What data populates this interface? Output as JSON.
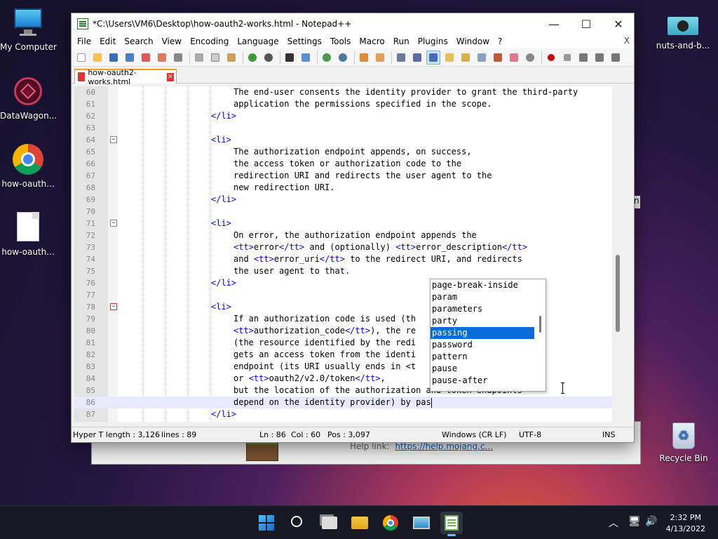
{
  "desktop": {
    "left_icons": [
      {
        "label": "My Computer",
        "icon": "monitor-icon"
      },
      {
        "label": "DataWagon...",
        "icon": "datawagon-icon"
      },
      {
        "label": "how-oauth...",
        "icon": "chrome-icon"
      },
      {
        "label": "how-oauth...",
        "icon": "file-icon"
      }
    ],
    "right_icons": [
      {
        "label": "nuts-and-b...",
        "icon": "image-file-icon"
      },
      {
        "label": "Recycle Bin",
        "icon": "recycle-bin-icon"
      }
    ]
  },
  "bg_window": {
    "help_label": "Help link:",
    "help_link": "https://help.mojang.c...",
    "right_edge_text": "n"
  },
  "window": {
    "title": "*C:\\Users\\VM6\\Desktop\\how-oauth2-works.html - Notepad++",
    "menu": [
      "File",
      "Edit",
      "Search",
      "View",
      "Encoding",
      "Language",
      "Settings",
      "Tools",
      "Macro",
      "Run",
      "Plugins",
      "Window",
      "?"
    ],
    "menu_close": "X",
    "tab": "how-oauth2-works.html",
    "controls": {
      "minimize": "—",
      "maximize": "☐",
      "close": "✕"
    }
  },
  "editor": {
    "lines": [
      {
        "n": "60",
        "text": "The end-user consents the identity provider to grant the third-party"
      },
      {
        "n": "61",
        "text": "application the permissions specified in the scope."
      },
      {
        "n": "62",
        "text": "</li>"
      },
      {
        "n": "63",
        "text": ""
      },
      {
        "n": "64",
        "text": "<li>"
      },
      {
        "n": "65",
        "text": "The authorization endpoint appends, on success,"
      },
      {
        "n": "66",
        "text": "the access token or authorization code to the"
      },
      {
        "n": "67",
        "text": "redirection URI and redirects the user agent to the"
      },
      {
        "n": "68",
        "text": "new redirection URI."
      },
      {
        "n": "69",
        "text": "</li>"
      },
      {
        "n": "70",
        "text": ""
      },
      {
        "n": "71",
        "text": "<li>"
      },
      {
        "n": "72",
        "text": "On error, the authorization endpoint appends the"
      },
      {
        "n": "73",
        "text": "<tt>error</tt> and (optionally) <tt>error_description</tt>"
      },
      {
        "n": "74",
        "text": "and <tt>error_uri</tt> to the redirect URI, and redirects"
      },
      {
        "n": "75",
        "text": "the user agent to that."
      },
      {
        "n": "76",
        "text": "</li>"
      },
      {
        "n": "77",
        "text": ""
      },
      {
        "n": "78",
        "text": "<li>"
      },
      {
        "n": "79",
        "text": "If an authorization code is used (th"
      },
      {
        "n": "80",
        "text": "<tt>authorization_code</tt>), the re"
      },
      {
        "n": "81",
        "text": "(the resource identified by the redi"
      },
      {
        "n": "82",
        "text": "gets an access token from the identi"
      },
      {
        "n": "83",
        "text": "endpoint (its URI usually ends in <t"
      },
      {
        "n": "84",
        "text": "or <tt>oauth2/v2.0/token</tt>,"
      },
      {
        "n": "85",
        "text": "but the location of the authorization and token endpoints"
      },
      {
        "n": "86",
        "text": "depend on the identity provider) by pas"
      },
      {
        "n": "87",
        "text": "</li>"
      }
    ],
    "autocomplete": [
      "page-break-inside",
      "param",
      "parameters",
      "party",
      "passing",
      "password",
      "pattern",
      "pause",
      "pause-after"
    ],
    "autocomplete_selected": "passing"
  },
  "status": {
    "type": "Hyper T length : 3,126",
    "lines": "lines : 89",
    "ln": "Ln : 86",
    "col": "Col : 60",
    "pos": "Pos : 3,097",
    "eol": "Windows (CR LF)",
    "encoding": "UTF-8",
    "mode": "INS"
  },
  "taskbar": {
    "time": "2:32 PM",
    "date": "4/13/2022"
  },
  "colors": {
    "tag": "#0000ff",
    "selection": "#0a6cd6",
    "tab_accent": "#f7a01a"
  }
}
